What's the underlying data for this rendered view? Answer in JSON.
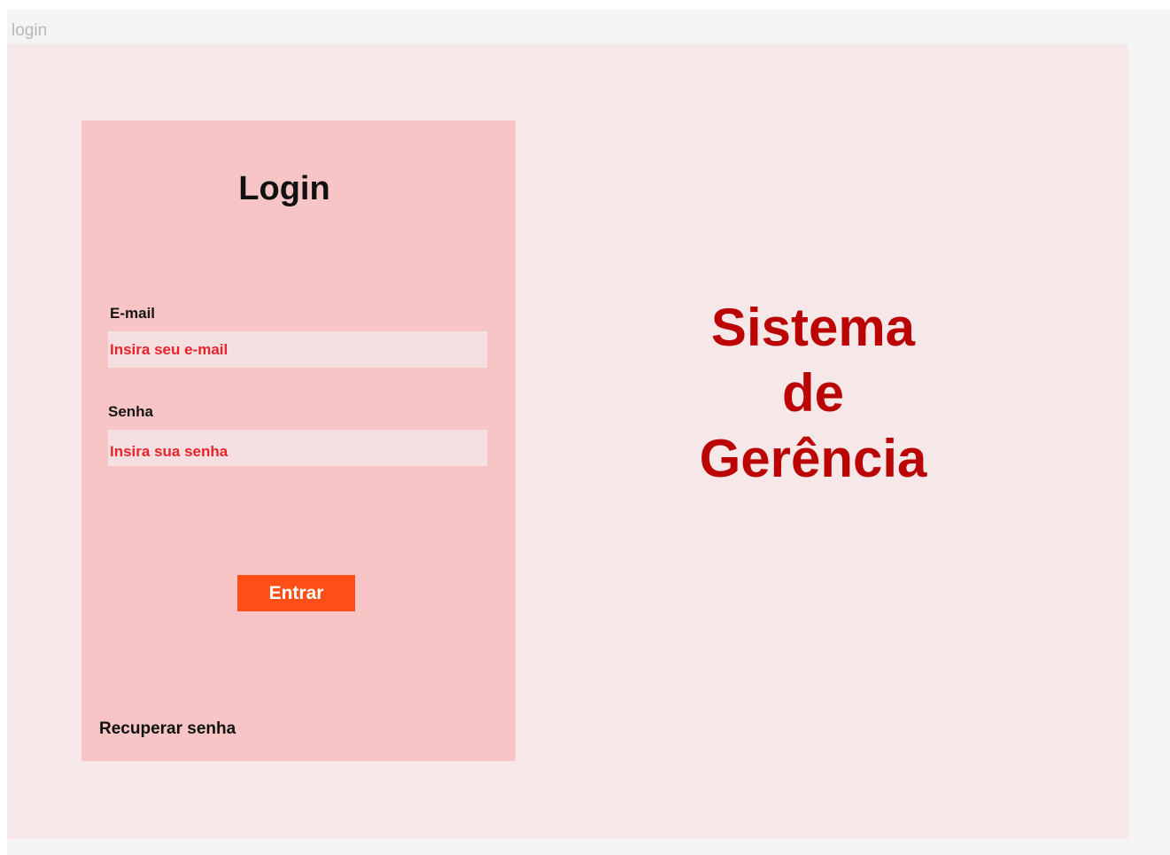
{
  "canvas": {
    "frame_label": "login"
  },
  "login_panel": {
    "title": "Login",
    "email": {
      "label": "E-mail",
      "placeholder": "Insira seu e-mail",
      "value": ""
    },
    "password": {
      "label": "Senha",
      "placeholder": "Insira sua senha",
      "value": ""
    },
    "submit_label": "Entrar",
    "recover_label": "Recuperar senha"
  },
  "headline": {
    "lines": [
      "Sistema",
      "de",
      "Gerência"
    ]
  },
  "colors": {
    "canvas_bg": "#f4f4f4",
    "frame_bg": "#f6e7e8",
    "panel_bg": "#f7c5c5",
    "input_bg": "#f6dfe0",
    "placeholder_text": "#e8232d",
    "button_bg": "#ff4f17",
    "headline_text": "#bb0404"
  }
}
